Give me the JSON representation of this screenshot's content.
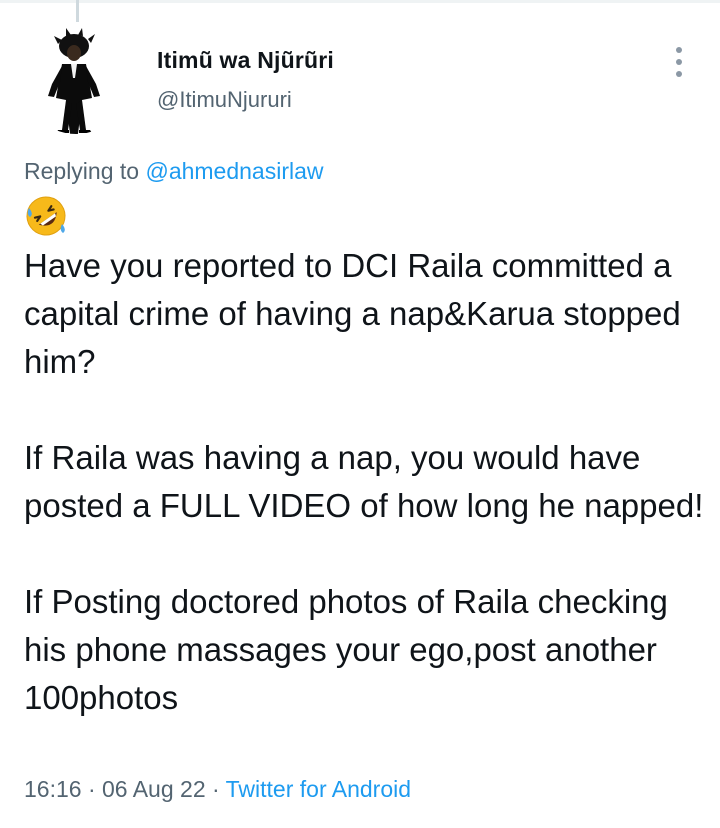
{
  "tweet": {
    "display_name": "Itimũ wa Njũrũri",
    "handle": "@ItimuNjururi",
    "replying_prefix": "Replying to ",
    "replying_to": "@ahmednasirlaw",
    "emoji": "rolling-on-the-floor-laughing",
    "text": "Have you reported to DCI Raila committed a capital crime of having a nap&Karua stopped him?\n\nIf Raila was having a nap, you would have posted a FULL VIDEO of how long he napped!\n\nIf Posting doctored photos of Raila checking his phone massages your ego,post another 100photos",
    "time": "16:16",
    "separator": " · ",
    "date": "06 Aug 22",
    "source": "Twitter for Android"
  },
  "colors": {
    "text": "#0f1419",
    "secondary": "#536471",
    "link": "#1d9bf0"
  },
  "icons": {
    "more": "more-vertical-icon",
    "avatar": "avatar"
  }
}
